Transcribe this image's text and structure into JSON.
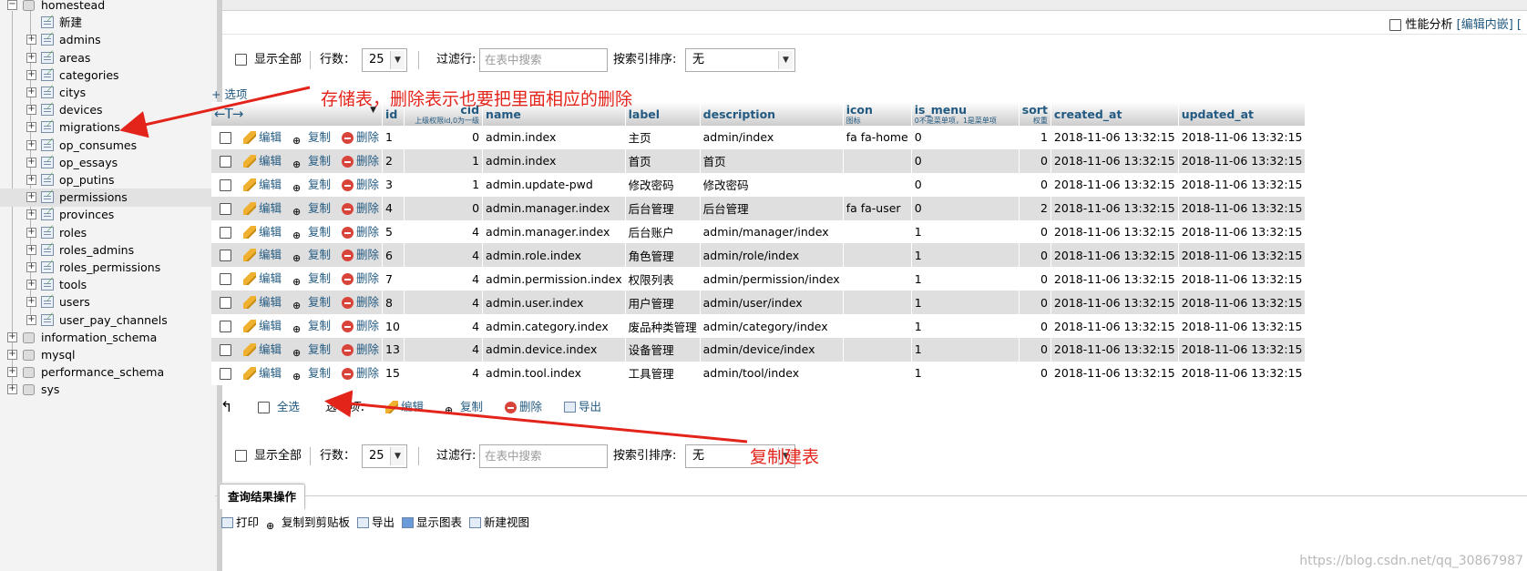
{
  "nav": {
    "root_db": "homestead",
    "new_item": "新建",
    "tables": [
      "admins",
      "areas",
      "categories",
      "citys",
      "devices",
      "migrations",
      "op_consumes",
      "op_essays",
      "op_putins",
      "permissions",
      "provinces",
      "roles",
      "roles_admins",
      "roles_permissions",
      "tools",
      "users",
      "user_pay_channels"
    ],
    "selected_table": "permissions",
    "other_dbs": [
      "information_schema",
      "mysql",
      "performance_schema",
      "sys"
    ]
  },
  "profiling": {
    "checkbox_label": "性能分析",
    "edit_inline": "[编辑内嵌]",
    "tail": "[ "
  },
  "controls": {
    "show_all": "显示全部",
    "rows_label": "行数：",
    "rows_value": "25",
    "filter_label": "过滤行:",
    "filter_placeholder": "在表中搜索",
    "sort_label": "按索引排序:",
    "sort_value": "无"
  },
  "table": {
    "options_link": "+ 选项",
    "arrows": "←T→",
    "actions": {
      "edit": "编辑",
      "copy": "复制",
      "delete": "删除"
    },
    "columns": [
      {
        "name": "id",
        "sub": ""
      },
      {
        "name": "cid",
        "sub": "上级权限id,0为一级"
      },
      {
        "name": "name",
        "sub": ""
      },
      {
        "name": "label",
        "sub": ""
      },
      {
        "name": "description",
        "sub": ""
      },
      {
        "name": "icon",
        "sub": "图标"
      },
      {
        "name": "is_menu",
        "sub": "0不是菜单项，1是菜单项"
      },
      {
        "name": "sort",
        "sub": "权重"
      },
      {
        "name": "created_at",
        "sub": ""
      },
      {
        "name": "updated_at",
        "sub": ""
      }
    ],
    "rows": [
      [
        "1",
        "0",
        "admin.index",
        "主页",
        "admin/index",
        "fa fa-home",
        "0",
        "1",
        "2018-11-06 13:32:15",
        "2018-11-06 13:32:15"
      ],
      [
        "2",
        "1",
        "admin.index",
        "首页",
        "首页",
        "",
        "0",
        "0",
        "2018-11-06 13:32:15",
        "2018-11-06 13:32:15"
      ],
      [
        "3",
        "1",
        "admin.update-pwd",
        "修改密码",
        "修改密码",
        "",
        "0",
        "0",
        "2018-11-06 13:32:15",
        "2018-11-06 13:32:15"
      ],
      [
        "4",
        "0",
        "admin.manager.index",
        "后台管理",
        "后台管理",
        "fa fa-user",
        "0",
        "2",
        "2018-11-06 13:32:15",
        "2018-11-06 13:32:15"
      ],
      [
        "5",
        "4",
        "admin.manager.index",
        "后台账户",
        "admin/manager/index",
        "",
        "1",
        "0",
        "2018-11-06 13:32:15",
        "2018-11-06 13:32:15"
      ],
      [
        "6",
        "4",
        "admin.role.index",
        "角色管理",
        "admin/role/index",
        "",
        "1",
        "0",
        "2018-11-06 13:32:15",
        "2018-11-06 13:32:15"
      ],
      [
        "7",
        "4",
        "admin.permission.index",
        "权限列表",
        "admin/permission/index",
        "",
        "1",
        "0",
        "2018-11-06 13:32:15",
        "2018-11-06 13:32:15"
      ],
      [
        "8",
        "4",
        "admin.user.index",
        "用户管理",
        "admin/user/index",
        "",
        "1",
        "0",
        "2018-11-06 13:32:15",
        "2018-11-06 13:32:15"
      ],
      [
        "10",
        "4",
        "admin.category.index",
        "废品种类管理",
        "admin/category/index",
        "",
        "1",
        "0",
        "2018-11-06 13:32:15",
        "2018-11-06 13:32:15"
      ],
      [
        "13",
        "4",
        "admin.device.index",
        "设备管理",
        "admin/device/index",
        "",
        "1",
        "0",
        "2018-11-06 13:32:15",
        "2018-11-06 13:32:15"
      ],
      [
        "15",
        "4",
        "admin.tool.index",
        "工具管理",
        "admin/tool/index",
        "",
        "1",
        "0",
        "2018-11-06 13:32:15",
        "2018-11-06 13:32:15"
      ]
    ]
  },
  "with_selected": {
    "check_all": "全选",
    "label": "选中项：",
    "edit": "编辑",
    "copy": "复制",
    "delete": "删除",
    "export": "导出"
  },
  "query_ops": {
    "tab": "查询结果操作",
    "actions": [
      "打印",
      "复制到剪贴板",
      "导出",
      "显示图表",
      "新建视图"
    ]
  },
  "annotations": {
    "storage_note": "存储表，删除表示也要把里面相应的删除",
    "copy_note": "复制建表",
    "color": "#e3241b"
  },
  "watermark": "https://blog.csdn.net/qq_30867987"
}
